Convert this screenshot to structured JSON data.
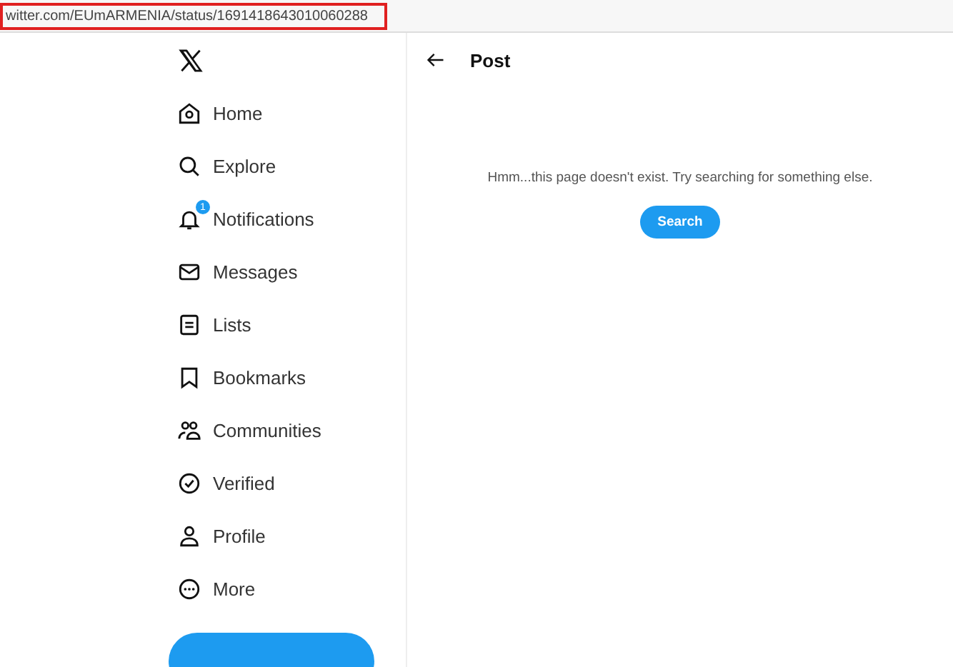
{
  "address_bar": {
    "url": "witter.com/EUmARMENIA/status/1691418643010060288",
    "highlighted": true
  },
  "sidebar": {
    "items": [
      {
        "label": "Home"
      },
      {
        "label": "Explore"
      },
      {
        "label": "Notifications",
        "badge": "1"
      },
      {
        "label": "Messages"
      },
      {
        "label": "Lists"
      },
      {
        "label": "Bookmarks"
      },
      {
        "label": "Communities"
      },
      {
        "label": "Verified"
      },
      {
        "label": "Profile"
      },
      {
        "label": "More"
      }
    ]
  },
  "header": {
    "title": "Post"
  },
  "empty_state": {
    "message": "Hmm...this page doesn't exist. Try searching for something else.",
    "button": "Search"
  }
}
